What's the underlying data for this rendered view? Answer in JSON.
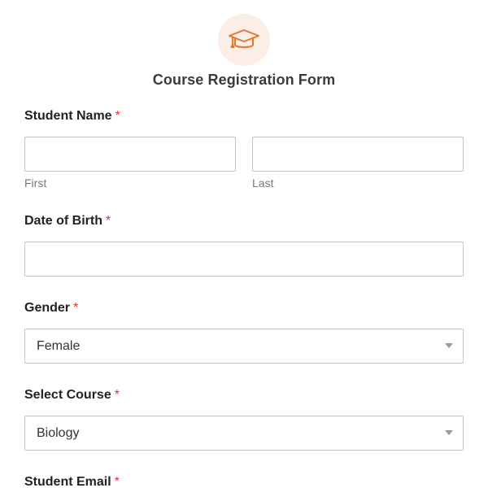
{
  "form": {
    "title": "Course Registration Form",
    "logo_icon": "graduation-cap-icon",
    "accent_color": "#e27730",
    "required_marker": "*",
    "required_color": "#d63637"
  },
  "fields": {
    "student_name": {
      "label": "Student Name",
      "first_value": "",
      "first_sublabel": "First",
      "last_value": "",
      "last_sublabel": "Last"
    },
    "date_of_birth": {
      "label": "Date of Birth",
      "value": ""
    },
    "gender": {
      "label": "Gender",
      "selected": "Female"
    },
    "course": {
      "label": "Select Course",
      "selected": "Biology"
    },
    "email": {
      "label": "Student Email"
    }
  }
}
